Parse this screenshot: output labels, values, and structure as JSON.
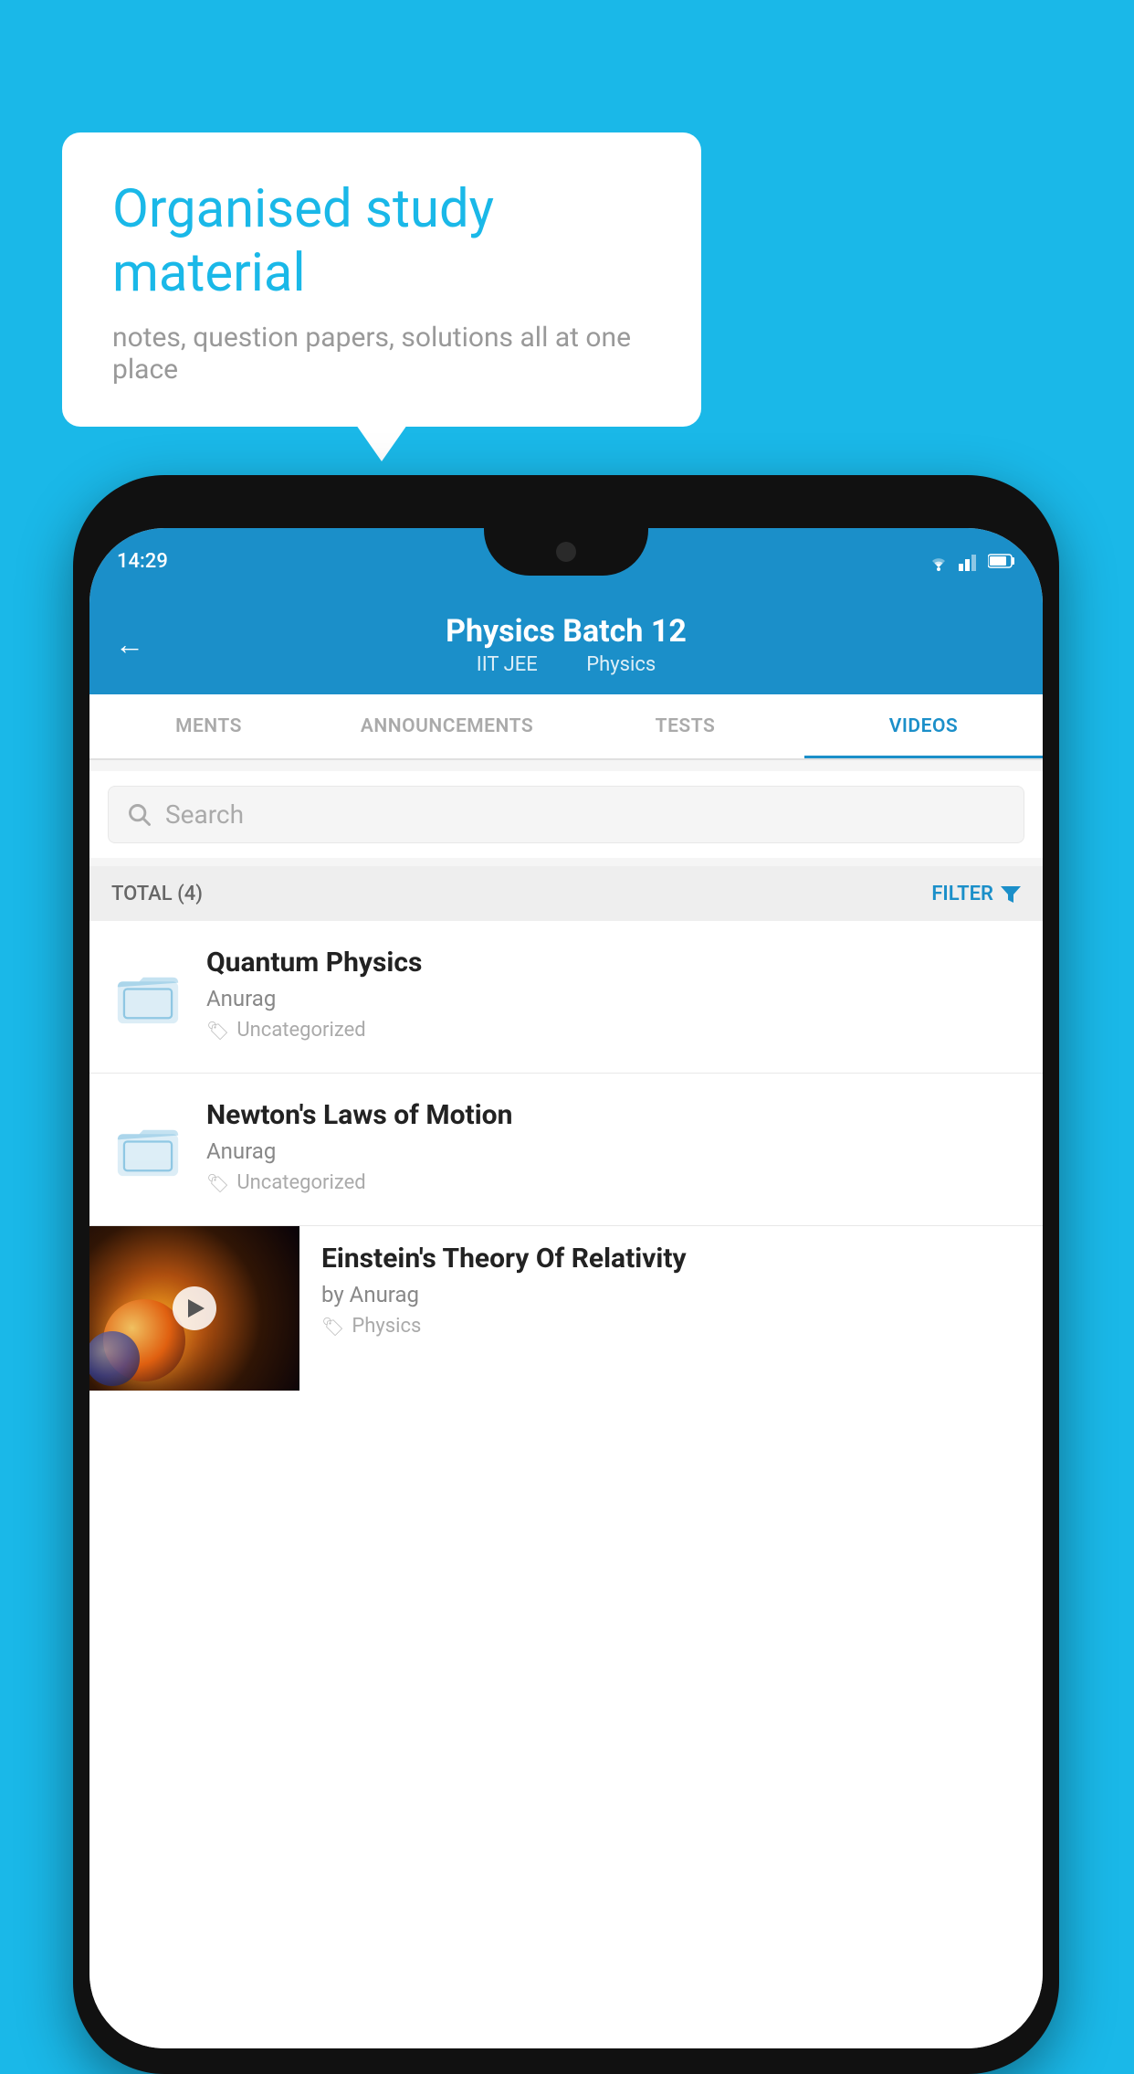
{
  "background_color": "#1ab8e8",
  "speech_bubble": {
    "title": "Organised study material",
    "subtitle": "notes, question papers, solutions all at one place"
  },
  "phone": {
    "status_bar": {
      "time": "14:29",
      "icons": [
        "wifi",
        "signal",
        "battery"
      ]
    },
    "app_header": {
      "back_label": "←",
      "title": "Physics Batch 12",
      "subtitle_parts": [
        "IIT JEE",
        "Physics"
      ]
    },
    "tabs": [
      {
        "label": "MENTS",
        "active": false
      },
      {
        "label": "ANNOUNCEMENTS",
        "active": false
      },
      {
        "label": "TESTS",
        "active": false
      },
      {
        "label": "VIDEOS",
        "active": true
      }
    ],
    "search": {
      "placeholder": "Search"
    },
    "filter_row": {
      "total_label": "TOTAL (4)",
      "filter_label": "FILTER"
    },
    "videos": [
      {
        "title": "Quantum Physics",
        "author": "Anurag",
        "tag": "Uncategorized",
        "has_thumbnail": false
      },
      {
        "title": "Newton's Laws of Motion",
        "author": "Anurag",
        "tag": "Uncategorized",
        "has_thumbnail": false
      },
      {
        "title": "Einstein's Theory Of Relativity",
        "author": "by Anurag",
        "tag": "Physics",
        "has_thumbnail": true
      }
    ]
  }
}
